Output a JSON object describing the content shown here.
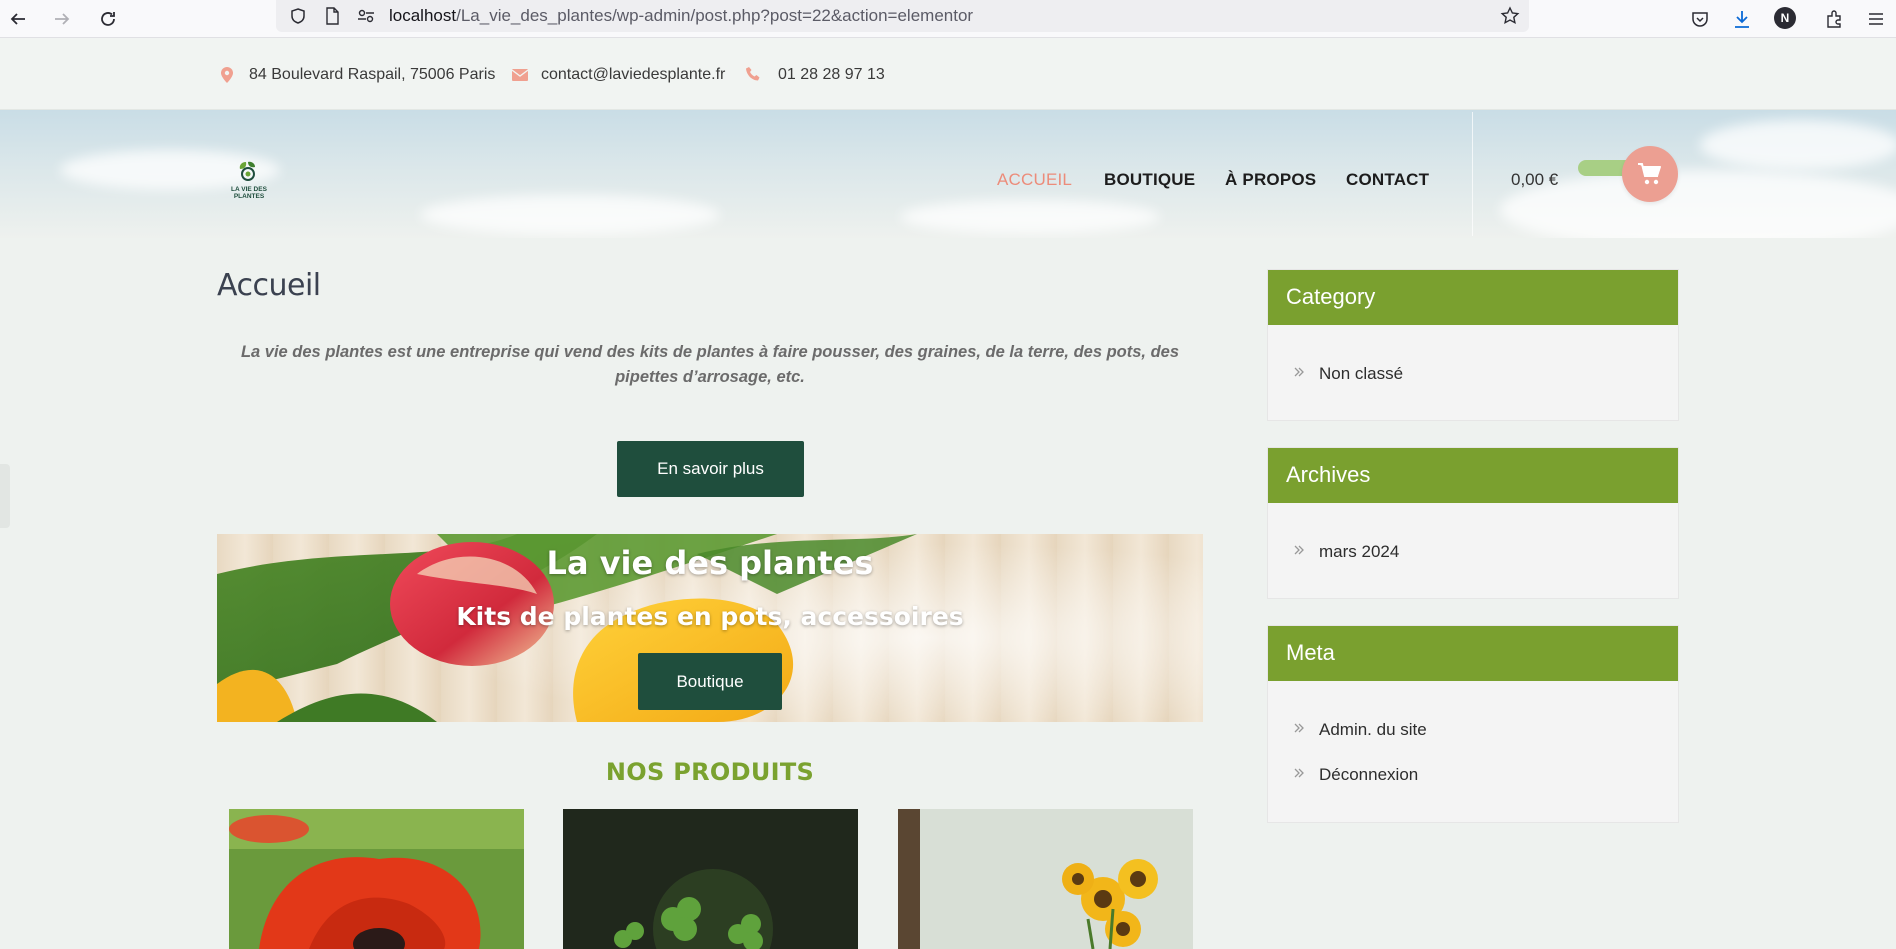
{
  "browser": {
    "url_host": "localhost",
    "url_path": "/La_vie_des_plantes/wp-admin/post.php?post=22&action=elementor",
    "profile_initial": "N"
  },
  "topbar": {
    "address": "84 Boulevard Raspail, 75006 Paris",
    "email": "contact@laviedesplante.fr",
    "phone": "01 28 28 97 13"
  },
  "header": {
    "logo_text_1": "LA VIE DES",
    "logo_text_2": "PLANTES",
    "menu": [
      {
        "label": "ACCUEIL",
        "active": true
      },
      {
        "label": "BOUTIQUE",
        "active": false
      },
      {
        "label": "À PROPOS",
        "active": false
      },
      {
        "label": "CONTACT",
        "active": false
      }
    ],
    "cart_total": "0,00 €"
  },
  "main": {
    "page_title": "Accueil",
    "intro": "La vie des plantes est une entreprise qui vend des kits de plantes à faire pousser, des graines, de la terre, des pots, des pipettes d’arrosage, etc.",
    "more_button": "En savoir plus",
    "hero": {
      "title": "La vie des plantes",
      "subtitle": "Kits de plantes en pots, accessoires",
      "button": "Boutique"
    },
    "products_title": "NOS PRODUITS"
  },
  "sidebar": {
    "category": {
      "title": "Category",
      "items": [
        "Non classé"
      ]
    },
    "archives": {
      "title": "Archives",
      "items": [
        "mars 2024"
      ]
    },
    "meta": {
      "title": "Meta",
      "items": [
        "Admin. du site",
        "Déconnexion"
      ]
    }
  },
  "colors": {
    "accent_green": "#7aa02f",
    "button_dark": "#1f4e3d",
    "active_menu": "#ec8c7a",
    "cart_button": "#ec9f92"
  }
}
